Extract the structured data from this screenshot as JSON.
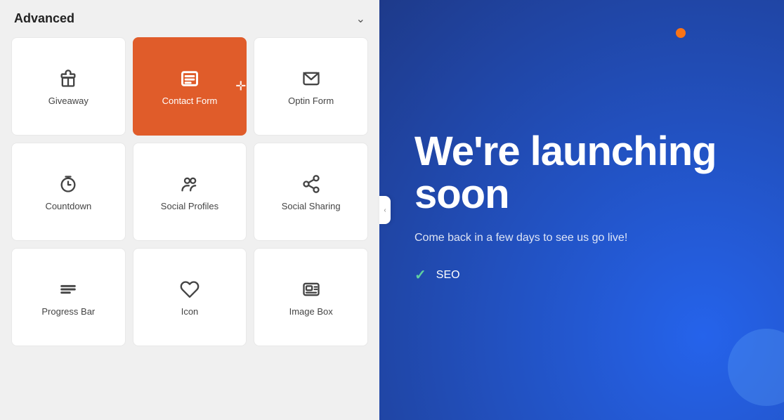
{
  "panel": {
    "title": "Advanced",
    "chevron": "chevron-down",
    "collapse_label": "<"
  },
  "grid_items": [
    {
      "id": "giveaway",
      "label": "Giveaway",
      "icon": "giveaway",
      "active": false
    },
    {
      "id": "contact-form",
      "label": "Contact Form",
      "icon": "contact-form",
      "active": true
    },
    {
      "id": "optin-form",
      "label": "Optin Form",
      "icon": "optin-form",
      "active": false
    },
    {
      "id": "countdown",
      "label": "Countdown",
      "icon": "countdown",
      "active": false
    },
    {
      "id": "social-profiles",
      "label": "Social Profiles",
      "icon": "social-profiles",
      "active": false
    },
    {
      "id": "social-sharing",
      "label": "Social Sharing",
      "icon": "social-sharing",
      "active": false
    },
    {
      "id": "progress-bar",
      "label": "Progress Bar",
      "icon": "progress-bar",
      "active": false
    },
    {
      "id": "icon",
      "label": "Icon",
      "icon": "icon-widget",
      "active": false
    },
    {
      "id": "image-box",
      "label": "Image Box",
      "icon": "image-box",
      "active": false
    }
  ],
  "preview": {
    "heading": "We're launching soon",
    "subtext": "Come back in a few days to see us go live!",
    "features": [
      {
        "label": "SEO"
      }
    ]
  },
  "colors": {
    "active_bg": "#e05c2a",
    "preview_bg": "#1e4fd8",
    "check_color": "#60d0a0",
    "dot_orange": "#f97316"
  }
}
